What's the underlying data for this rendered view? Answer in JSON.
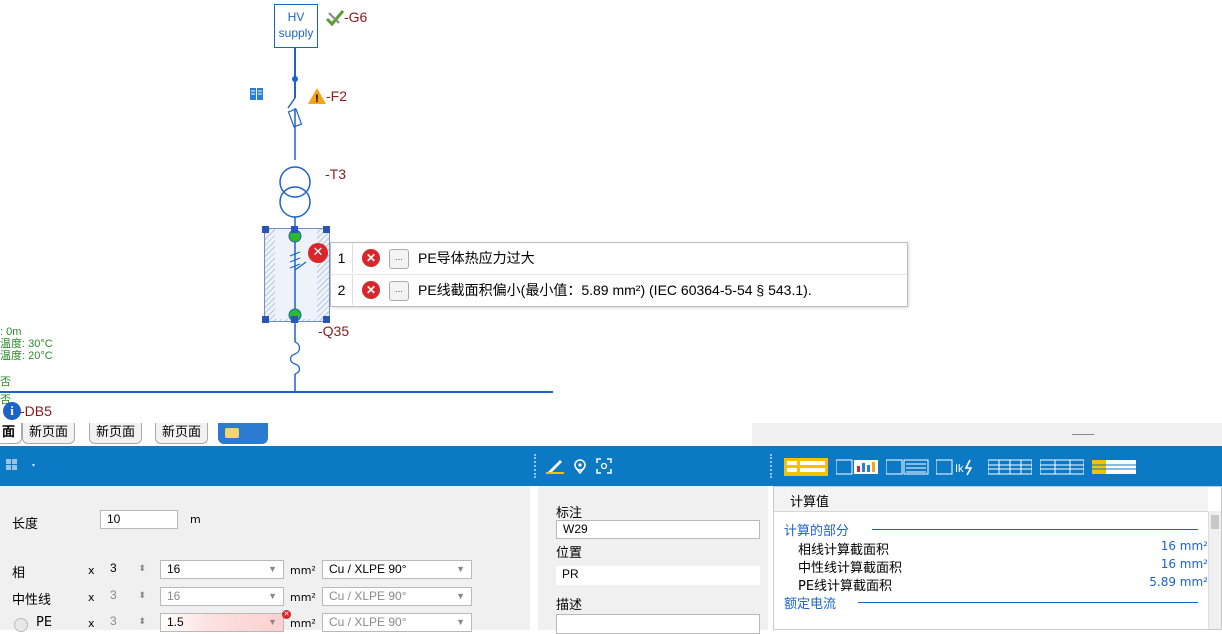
{
  "diagram": {
    "hv_supply": {
      "line1": "HV",
      "line2": "supply"
    },
    "labels": {
      "g6": "-G6",
      "f2": "-F2",
      "t3": "-T3",
      "q35": "-Q35",
      "db5": "-DB5"
    },
    "left_texts": [
      ": 0m",
      "温度: 30°C",
      "温度: 20°C",
      "否",
      "否"
    ],
    "errors": [
      {
        "num": "1",
        "btn": "...",
        "text": "PE导体热应力过大"
      },
      {
        "num": "2",
        "btn": "...",
        "text": "PE线截面积偏小(最小值：5.89 mm²) (IEC 60364-5-54 § 543.1)."
      }
    ],
    "colors": {
      "wire": "#1c63c9",
      "label": "#8b1a1a",
      "error": "#d9262b"
    }
  },
  "tabs": [
    "面",
    "新页面",
    "新页面",
    "新页面"
  ],
  "left_panel": {
    "length": {
      "label": "长度",
      "value": "10",
      "unit": "m"
    },
    "rows": [
      {
        "label": "相",
        "x": "x",
        "count": "3",
        "size": "16",
        "unit": "mm²",
        "material": "Cu / XLPE 90°"
      },
      {
        "label": "中性线",
        "x": "x",
        "count": "3",
        "size": "16",
        "unit": "mm²",
        "material": "Cu / XLPE 90°"
      },
      {
        "label": "PE",
        "x": "x",
        "count": "3",
        "size": "1.5",
        "unit": "mm²",
        "material": "Cu / XLPE 90°"
      }
    ]
  },
  "mid_panel": {
    "mark_label": "标注",
    "mark_value": "W29",
    "position_label": "位置",
    "position_value": "PR",
    "desc_label": "描述"
  },
  "right_panel": {
    "header": "计算值",
    "section1": "计算的部分",
    "rows": [
      {
        "label": "相线计算截面积",
        "value": "16 mm²"
      },
      {
        "label": "中性线计算截面积",
        "value": "16 mm²"
      },
      {
        "label": "PE线计算截面积",
        "value": "5.89 mm²"
      }
    ],
    "section2": "额定电流"
  }
}
